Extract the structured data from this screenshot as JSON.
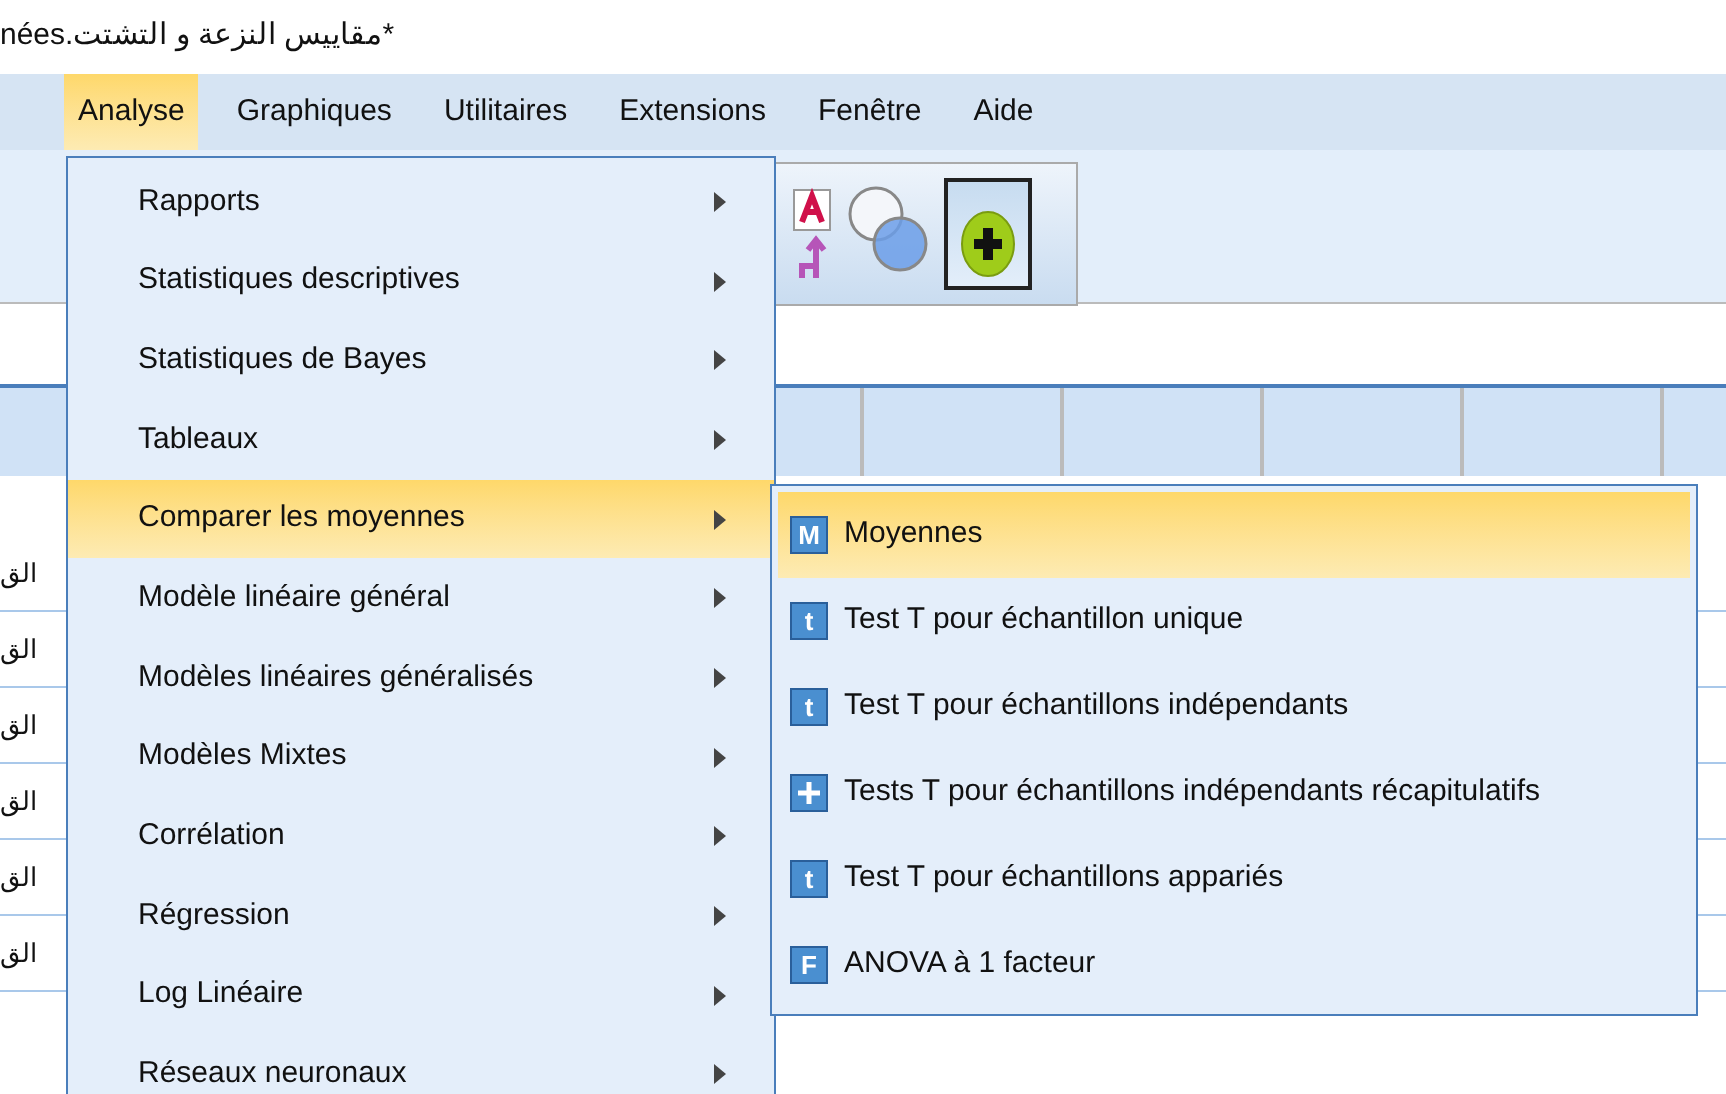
{
  "window": {
    "title": "*مقاييس النزعة و التشتت.nées"
  },
  "menu_bar": [
    {
      "label": "Analyse",
      "selected": true
    },
    {
      "label": "Graphiques",
      "selected": false
    },
    {
      "label": "Utilitaires",
      "selected": false
    },
    {
      "label": "Extensions",
      "selected": false
    },
    {
      "label": "Fenêtre",
      "selected": false
    },
    {
      "label": "Aide",
      "selected": false
    }
  ],
  "analyse_menu": [
    {
      "label": "Rapports",
      "selected": false
    },
    {
      "label": "Statistiques descriptives",
      "selected": false
    },
    {
      "label": "Statistiques de Bayes",
      "selected": false
    },
    {
      "label": "Tableaux",
      "selected": false
    },
    {
      "label": "Comparer les moyennes",
      "selected": true
    },
    {
      "label": "Modèle linéaire général",
      "selected": false
    },
    {
      "label": "Modèles linéaires généralisés",
      "selected": false
    },
    {
      "label": "Modèles Mixtes",
      "selected": false
    },
    {
      "label": "Corrélation",
      "selected": false
    },
    {
      "label": "Régression",
      "selected": false
    },
    {
      "label": "Log Linéaire",
      "selected": false
    },
    {
      "label": "Réseaux neuronaux",
      "selected": false
    }
  ],
  "submenu": [
    {
      "label": "Moyennes",
      "selected": true,
      "icon": {
        "kind": "letter",
        "glyph": "M"
      }
    },
    {
      "label": "Test T pour échantillon unique",
      "selected": false,
      "icon": {
        "kind": "letter",
        "glyph": "t"
      }
    },
    {
      "label": "Test T pour échantillons indépendants",
      "selected": false,
      "icon": {
        "kind": "letter",
        "glyph": "t"
      }
    },
    {
      "label": "Tests T pour échantillons indépendants récapitulatifs",
      "selected": false,
      "icon": {
        "kind": "plus"
      }
    },
    {
      "label": "Test T pour échantillons appariés",
      "selected": false,
      "icon": {
        "kind": "letter",
        "glyph": "t"
      }
    },
    {
      "label": "ANOVA à 1 facteur",
      "selected": false,
      "icon": {
        "kind": "letter",
        "glyph": "F"
      }
    }
  ],
  "row_labels": [
    "الق",
    "الق",
    "الق",
    "الق",
    "الق",
    "الق"
  ]
}
